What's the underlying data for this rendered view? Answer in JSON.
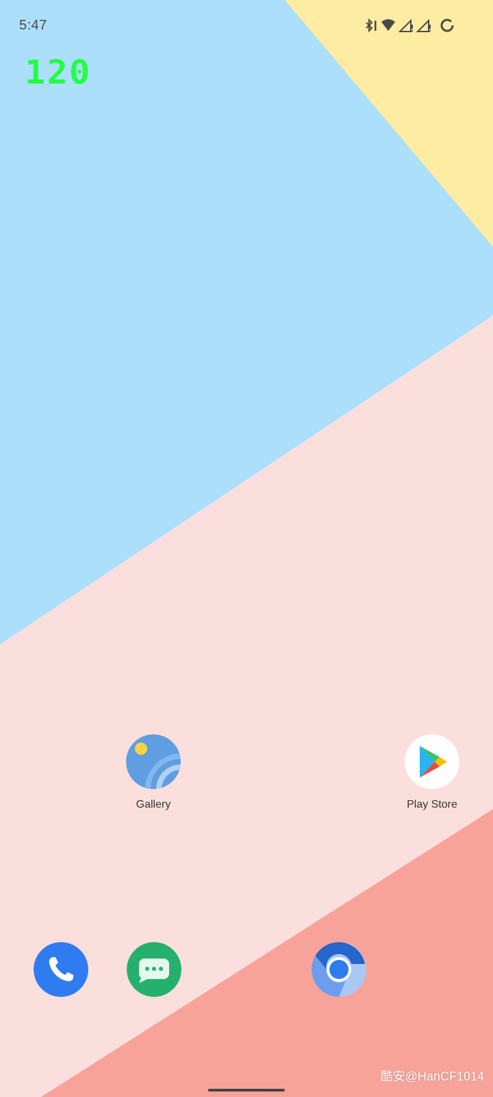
{
  "status_bar": {
    "time": "5:47",
    "icons": [
      "bluetooth-icon",
      "wifi-icon",
      "signal-sim1-icon",
      "signal-sim2-icon",
      "battery-ring-icon"
    ]
  },
  "overlay": {
    "fps": "120"
  },
  "wallpaper": {
    "colors": {
      "blue": "#abdffb",
      "yellow": "#fdeca1",
      "pink": "#fbdfdd",
      "coral": "#f8a39a"
    }
  },
  "home_apps": [
    {
      "label": "Gallery",
      "icon": "gallery-icon"
    },
    {
      "label": "Play Store",
      "icon": "play-store-icon"
    }
  ],
  "dock": [
    {
      "icon": "phone-icon",
      "color": "#2f7cf0"
    },
    {
      "icon": "messages-icon",
      "color": "#26b06e"
    },
    {
      "icon": "browser-icon",
      "color": "#2466cc"
    }
  ],
  "watermark": "酷安@HanCF1014"
}
